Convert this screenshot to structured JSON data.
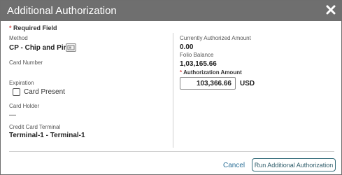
{
  "dialog": {
    "title": "Additional Authorization",
    "close_icon": "close-icon"
  },
  "required": {
    "star": "*",
    "text": "Required Field"
  },
  "left": {
    "method_label": "Method",
    "method_value": "CP - Chip and Pin",
    "card_icon": "credit-card-icon",
    "card_number_label": "Card Number",
    "expiration_label": "Expiration",
    "card_present_label": "Card Present",
    "card_present_checked": false,
    "card_holder_label": "Card Holder",
    "card_holder_value": "—",
    "terminal_label": "Credit Card Terminal",
    "terminal_value": "Terminal-1 - Terminal-1"
  },
  "right": {
    "authorized_label": "Currently Authorized Amount",
    "authorized_value": "0.00",
    "folio_label": "Folio Balance",
    "folio_value": "1,03,165.66",
    "auth_amount_star": "*",
    "auth_amount_label": "Authorization Amount",
    "auth_amount_value": "103,366.66",
    "currency": "USD"
  },
  "footer": {
    "cancel_label": "Cancel",
    "run_label": "Run Additional Authorization"
  },
  "colors": {
    "titlebar": "#6f6f6f",
    "required_star": "#d9534f",
    "link": "#2a6f97",
    "button_border": "#356c7a"
  }
}
